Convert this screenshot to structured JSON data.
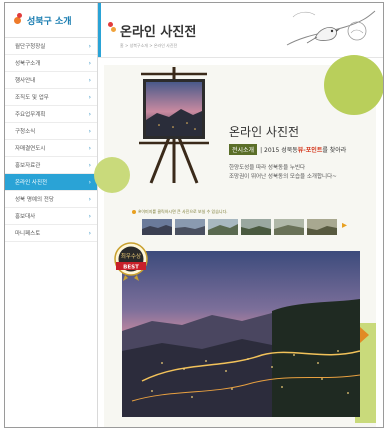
{
  "sidebar": {
    "logo_text": "성북구 소개",
    "items": [
      {
        "label": "월단구청장실",
        "active": false
      },
      {
        "label": "성북구소개",
        "active": false
      },
      {
        "label": "행사안내",
        "active": false
      },
      {
        "label": "조직도 및 업무",
        "active": false
      },
      {
        "label": "주요업무계획",
        "active": false
      },
      {
        "label": "구청소식",
        "active": false
      },
      {
        "label": "자매결연도시",
        "active": false
      },
      {
        "label": "홍보자료관",
        "active": false
      },
      {
        "label": "온라인 사진전",
        "active": true
      },
      {
        "label": "성북 명예의 전당",
        "active": false
      },
      {
        "label": "홍보대사",
        "active": false
      },
      {
        "label": "마니페스토",
        "active": false
      }
    ]
  },
  "header": {
    "title": "온라인 사진전",
    "breadcrumb": "홈 > 성북구소개 > 온라인 사진전"
  },
  "info": {
    "title": "온라인 사진전",
    "tag": "전시소개",
    "subtitle_prefix": "| 2015 성북동 ",
    "subtitle_highlight": "뷰-포인트",
    "subtitle_suffix": "를 찾아라",
    "desc_line1": "한양도성을 따라 성북동을 누빈다",
    "desc_line2": "조망권이 뛰어난 성북동의 모습을 소개합니다~"
  },
  "gallery": {
    "hint": "※이미지를 클릭하시면 큰 사진으로 보실 수 있습니다.",
    "badge_line1": "최우수상",
    "badge_line2": "BEST"
  },
  "colors": {
    "accent_blue": "#2aa3d6",
    "accent_orange": "#e28a25",
    "tag_green": "#5a6e28",
    "highlight_red": "#d4361c"
  }
}
